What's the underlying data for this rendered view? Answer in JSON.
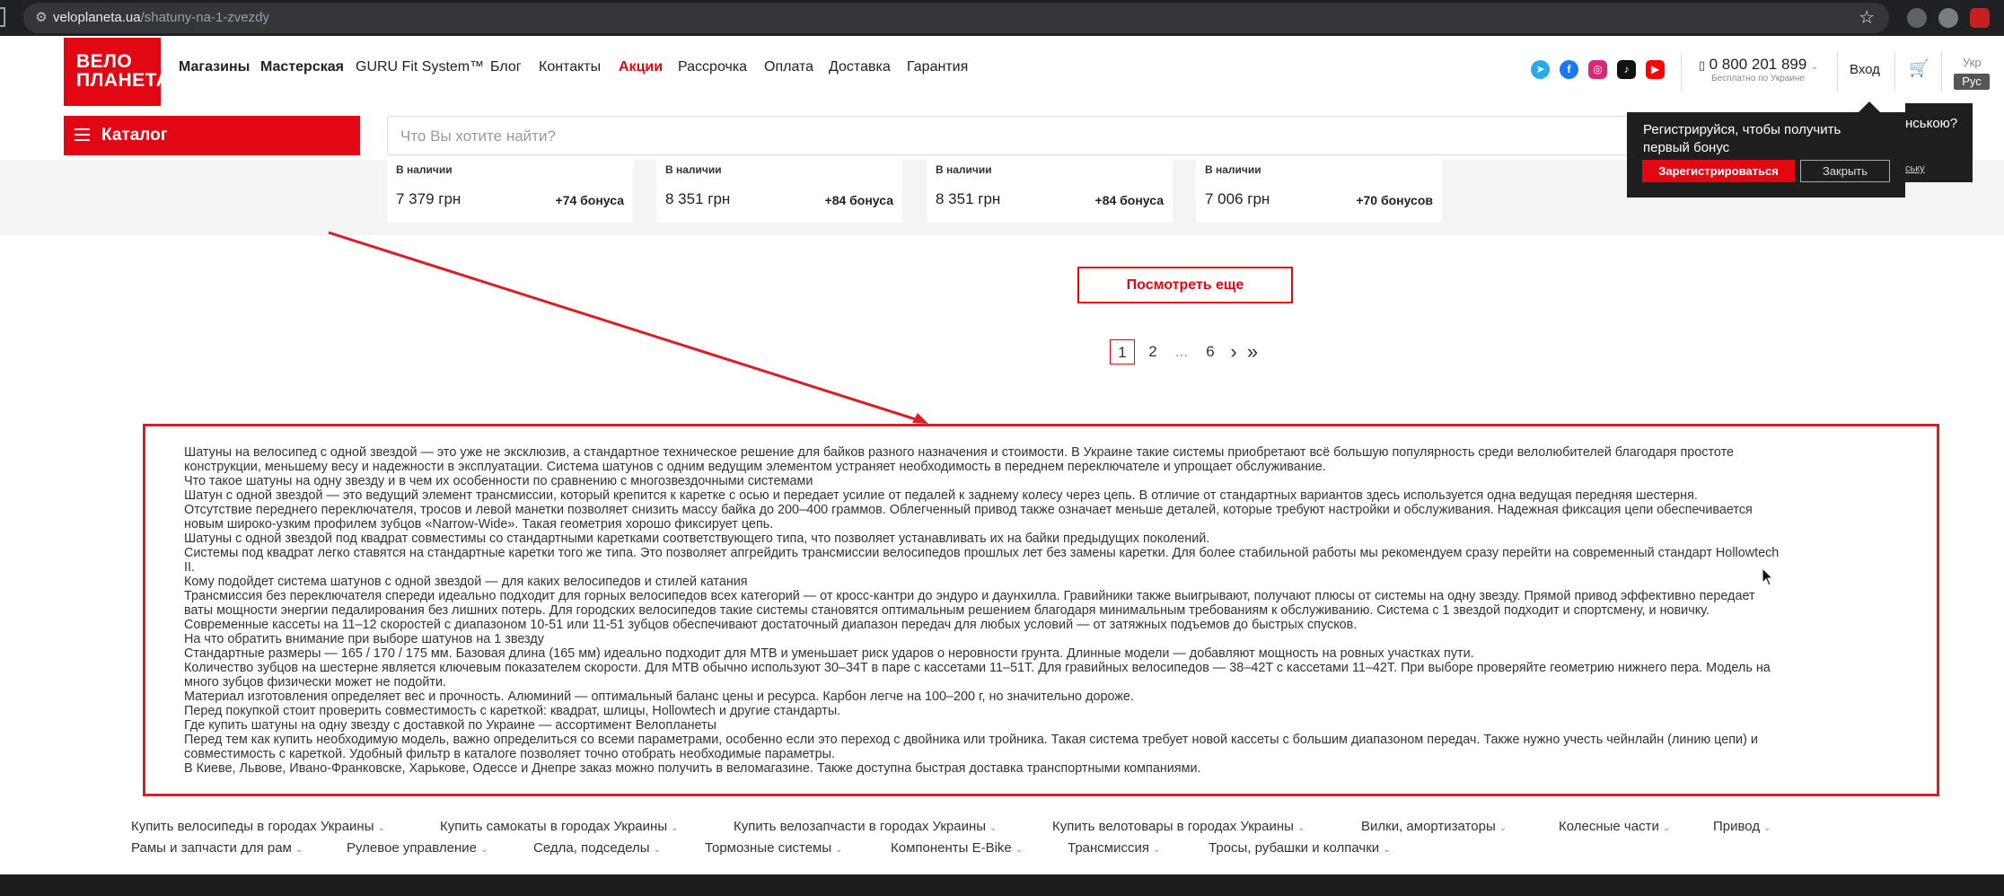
{
  "browser": {
    "url_host": "veloplaneta.ua",
    "url_path": "/shatuny-na-1-zvezdy"
  },
  "header": {
    "logo_line1": "ВЕЛО",
    "logo_line2": "ПЛАНЕТА",
    "nav": [
      {
        "label": "Магазины"
      },
      {
        "label": "Мастерская"
      },
      {
        "label": "GURU Fit System™"
      },
      {
        "label": "Блог"
      },
      {
        "label": "Контакты"
      },
      {
        "label": "Акции"
      },
      {
        "label": "Рассрочка"
      },
      {
        "label": "Оплата"
      },
      {
        "label": "Доставка"
      },
      {
        "label": "Гарантия"
      }
    ],
    "social_icons": [
      "telegram-icon",
      "facebook-icon",
      "instagram-icon",
      "tiktok-icon",
      "youtube-icon"
    ],
    "phone": "0 800 201 899",
    "phone_sub": "Бесплатно по Украине",
    "login": "Вход",
    "lang_ukr": "Укр",
    "lang_rus": "Рус"
  },
  "catalog_label": "Каталог",
  "search": {
    "placeholder": "Что Вы хотите найти?"
  },
  "products": [
    {
      "stock": "В наличии",
      "price": "7 379 грн",
      "bonus": "+74 бонуса"
    },
    {
      "stock": "В наличии",
      "price": "8 351 грн",
      "bonus": "+84 бонуса"
    },
    {
      "stock": "В наличии",
      "price": "8 351 грн",
      "bonus": "+84 бонуса"
    },
    {
      "stock": "В наличии",
      "price": "7 006 грн",
      "bonus": "+70 бонусов"
    }
  ],
  "popup": {
    "message": "Регистрируйся, чтобы получить первый бонус",
    "register": "Зарегистрироваться",
    "close": "Закрыть",
    "partial_text": "нською?",
    "partial_link": "ську"
  },
  "load_more": "Посмотреть еще",
  "pagination": {
    "pages": [
      "1",
      "2",
      "...",
      "6"
    ],
    "next": "›",
    "last": "»",
    "active": "1"
  },
  "seo_lines": [
    "Шатуны на велосипед с одной звездой — это уже не эксклюзив, а стандартное техническое решение для байков разного назначения и стоимости. В Украине такие системы приобретают всё большую популярность среди велолюбителей благодаря простоте",
    "конструкции, меньшему весу и надежности в эксплуатации. Система шатунов с одним ведущим элементом устраняет необходимость в переднем переключателе и упрощает обслуживание.",
    "Что такое шатуны на одну звезду и в чем их особенности по сравнению с многозвездочными системами",
    "Шатун с одной звездой — это ведущий элемент трансмиссии, который крепится к каретке с осью и передает усилие от педалей к заднему колесу через цепь. В отличие от стандартных вариантов здесь используется одна ведущая передняя шестерня.",
    "Отсутствие переднего переключателя, тросов и левой манетки позволяет снизить массу байка до 200–400 граммов. Облегченный привод также означает меньше деталей, которые требуют настройки и обслуживания. Надежная фиксация цепи обеспечивается",
    "новым широко-узким профилем зубцов «Narrow-Wide». Такая геометрия хорошо фиксирует цепь.",
    "Шатуны с одной звездой под квадрат совместимы со стандартными каретками соответствующего типа, что позволяет устанавливать их на байки предыдущих поколений.",
    "Системы под квадрат легко ставятся на стандартные каретки того же типа. Это позволяет апгрейдить трансмиссии велосипедов прошлых лет без замены каретки. Для более стабильной работы мы рекомендуем сразу перейти на современный стандарт Hollowtech",
    "II.",
    "Кому подойдет система шатунов с одной звездой — для каких велосипедов и стилей катания",
    "Трансмиссия без переключателя спереди идеально подходит для горных велосипедов всех категорий — от кросс-кантри до эндуро и даунхилла. Гравийники также выигрывают, получают плюсы от системы на одну звезду. Прямой привод эффективно передает",
    "ваты мощности энергии педалирования без лишних потерь. Для городских велосипедов такие системы становятся оптимальным решением благодаря минимальным требованиям к обслуживанию. Система с 1 звездой подходит и спортсмену, и новичку.",
    "Современные кассеты на 11–12 скоростей с диапазоном 10-51 или 11-51 зубцов обеспечивают достаточный диапазон передач для любых условий — от затяжных подъемов до быстрых спусков.",
    "На что обратить внимание при выборе шатунов на 1 звезду",
    "Стандартные размеры — 165 / 170 / 175 мм. Базовая длина (165 мм) идеально подходит для МТВ и уменьшает риск ударов о неровности грунта. Длинные модели — добавляют мощность на ровных участках пути.",
    "Количество зубцов на шестерне является ключевым показателем скорости. Для МТВ обычно используют 30–34T в паре с кассетами 11–51T. Для гравийных велосипедов — 38–42T с кассетами 11–42T. При выборе проверяйте геометрию нижнего пера. Модель на",
    "много зубцов физически может не подойти.",
    "Материал изготовления определяет вес и прочность. Алюминий — оптимальный баланс цены и ресурса. Карбон легче на 100–200 г, но значительно дороже.",
    "Перед покупкой стоит проверить совместимость с кареткой: квадрат, шлицы, Hollowtech и другие стандарты.",
    "Где купить шатуны на одну звезду с доставкой по Украине — ассортимент Велопланеты",
    "Перед тем как купить необходимую модель, важно определиться со всеми параметрами, особенно если это переход с двойника или тройника. Такая система требует новой кассеты с большим диапазоном передач. Также нужно учесть чейнлайн (линию цепи) и",
    "совместимость с кареткой. Удобный фильтр в каталоге позволяет точно отобрать необходимые параметры.",
    "В Киеве, Львове, Ивано-Франковске, Харькове, Одессе и Днепре заказ можно получить в веломагазине. Также доступна быстрая доставка транспортными компаниями."
  ],
  "footer_row1": [
    "Купить велосипеды в городах Украины",
    "Купить самокаты в городах Украины",
    "Купить велозапчасти в городах Украины",
    "Купить велотовары в городах Украины",
    "Вилки, амортизаторы",
    "Колесные части",
    "Привод"
  ],
  "footer_row2": [
    "Рамы и запчасти для рам",
    "Рулевое управление",
    "Седла, подседелы",
    "Тормозные системы",
    "Компоненты E-Bike",
    "Трансмиссия",
    "Тросы, рубашки и колпачки"
  ],
  "colors": {
    "brand": "#e30613",
    "annotation": "#d61f26",
    "chrome": "#202124"
  }
}
